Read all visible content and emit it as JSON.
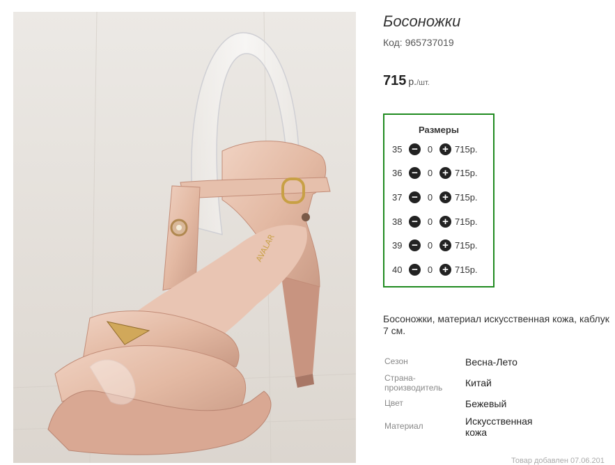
{
  "product": {
    "title": "Босоножки",
    "code": "Код: 965737019",
    "price": "715",
    "currency": "р.",
    "unit": "/шт.",
    "image_brand": "AVALAR",
    "description": "Босоножки, материал искусственная кожа, каблук 7 см."
  },
  "sizes": {
    "title": "Размеры",
    "minus_icon": "minus-circle-icon",
    "plus_icon": "plus-circle-icon",
    "rows": [
      {
        "size": "35",
        "qty": "0",
        "price": "715р."
      },
      {
        "size": "36",
        "qty": "0",
        "price": "715р."
      },
      {
        "size": "37",
        "qty": "0",
        "price": "715р."
      },
      {
        "size": "38",
        "qty": "0",
        "price": "715р."
      },
      {
        "size": "39",
        "qty": "0",
        "price": "715р."
      },
      {
        "size": "40",
        "qty": "0",
        "price": "715р."
      }
    ]
  },
  "properties": [
    {
      "key": "Сезон",
      "value": "Весна-Лето"
    },
    {
      "key": "Страна-производитель",
      "value": "Китай"
    },
    {
      "key": "Цвет",
      "value": "Бежевый"
    },
    {
      "key": "Материал",
      "value": "Искусственная кожа"
    }
  ],
  "footnote": "Товар добавлен 07.06.201",
  "colors": {
    "accent_border": "#1f8a1f",
    "shoe": "#e3bba6"
  }
}
